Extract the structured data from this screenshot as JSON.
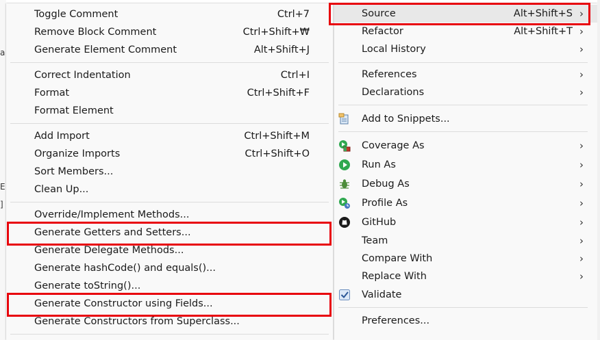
{
  "left_menu": {
    "toggle_comment": {
      "label": "Toggle Comment",
      "shortcut": "Ctrl+7"
    },
    "remove_block_comment": {
      "label": "Remove Block Comment",
      "shortcut": "Ctrl+Shift+₩"
    },
    "generate_element_comment": {
      "label": "Generate Element Comment",
      "shortcut": "Alt+Shift+J"
    },
    "correct_indentation": {
      "label": "Correct Indentation",
      "shortcut": "Ctrl+I"
    },
    "format": {
      "label": "Format",
      "shortcut": "Ctrl+Shift+F"
    },
    "format_element": {
      "label": "Format Element"
    },
    "add_import": {
      "label": "Add Import",
      "shortcut": "Ctrl+Shift+M"
    },
    "organize_imports": {
      "label": "Organize Imports",
      "shortcut": "Ctrl+Shift+O"
    },
    "sort_members": {
      "label": "Sort Members..."
    },
    "clean_up": {
      "label": "Clean Up..."
    },
    "override_implement": {
      "label": "Override/Implement Methods..."
    },
    "getters_setters": {
      "label": "Generate Getters and Setters..."
    },
    "delegate_methods": {
      "label": "Generate Delegate Methods..."
    },
    "hashcode_equals": {
      "label": "Generate hashCode() and equals()..."
    },
    "tostring": {
      "label": "Generate toString()..."
    },
    "constructor_fields": {
      "label": "Generate Constructor using Fields..."
    },
    "constructors_superclass": {
      "label": "Generate Constructors from Superclass..."
    }
  },
  "right_menu": {
    "source": {
      "label": "Source",
      "shortcut": "Alt+Shift+S"
    },
    "refactor": {
      "label": "Refactor",
      "shortcut": "Alt+Shift+T"
    },
    "local_history": {
      "label": "Local History"
    },
    "references": {
      "label": "References"
    },
    "declarations": {
      "label": "Declarations"
    },
    "add_to_snippets": {
      "label": "Add to Snippets...",
      "icon": "snippets-icon"
    },
    "coverage_as": {
      "label": "Coverage As",
      "icon": "coverage-icon"
    },
    "run_as": {
      "label": "Run As",
      "icon": "run-icon"
    },
    "debug_as": {
      "label": "Debug As",
      "icon": "debug-icon"
    },
    "profile_as": {
      "label": "Profile As",
      "icon": "profile-icon"
    },
    "github": {
      "label": "GitHub",
      "icon": "github-icon"
    },
    "team": {
      "label": "Team"
    },
    "compare_with": {
      "label": "Compare With"
    },
    "replace_with": {
      "label": "Replace With"
    },
    "validate": {
      "label": "Validate",
      "icon": "checkbox-icon"
    },
    "preferences": {
      "label": "Preferences..."
    }
  },
  "submenu_arrow": "›",
  "edge_glyphs": [
    "a",
    "E",
    "]"
  ],
  "colors": {
    "highlight": "#e8000b",
    "menu_bg": "#f9f9f9",
    "hover": "#e8e8e8",
    "run_green": "#2fa84f"
  }
}
